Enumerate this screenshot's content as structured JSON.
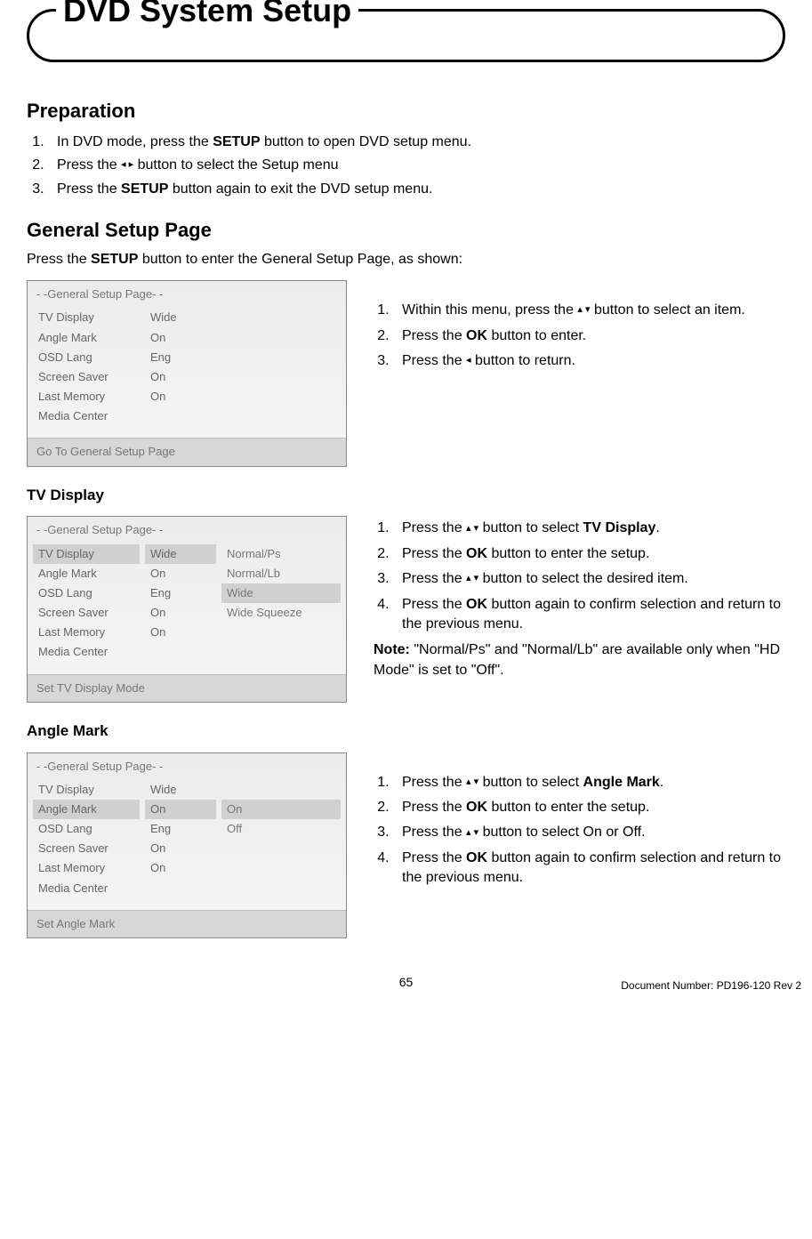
{
  "title": "DVD System Setup",
  "preparation": {
    "heading": "Preparation",
    "step1_a": "In DVD mode, press the ",
    "step1_b": "SETUP",
    "step1_c": " button to open DVD setup menu.",
    "step2_a": "Press the ",
    "step2_arrows": "◂  ▸",
    "step2_b": " button to select the Setup menu",
    "step3_a": "Press the ",
    "step3_b": "SETUP",
    "step3_c": " button again to exit the DVD setup menu."
  },
  "general": {
    "heading": "General Setup Page",
    "intro_a": "Press the ",
    "intro_b": "SETUP",
    "intro_c": " button to enter the General Setup Page, as shown:"
  },
  "menu_common": {
    "title": "- -General Setup Page- -",
    "labels": [
      "TV Display",
      "Angle Mark",
      "OSD Lang",
      "Screen Saver",
      "Last Memory",
      "Media Center"
    ],
    "vals": [
      "Wide",
      "On",
      "Eng",
      "On",
      "On",
      ""
    ]
  },
  "menu1_footer": "Go To General Setup Page",
  "steps1": {
    "s1a": "Within this menu, press the ",
    "s1arrows": "▴ ▾",
    "s1b": " button to select an item.",
    "s2a": "Press the ",
    "s2b": "OK",
    "s2c": " button to enter.",
    "s3a": "Press the ",
    "s3arrow": "◂",
    "s3b": " button to return."
  },
  "tvdisplay": {
    "subhead": "TV Display",
    "options": [
      "Normal/Ps",
      "Normal/Lb",
      "Wide",
      "Wide Squeeze"
    ],
    "sel_option_index": 2,
    "sel_label_index": 0,
    "footer": "Set TV Display Mode",
    "s1a": "Press the ",
    "s1arrows": "▴ ▾",
    "s1b": " button to select ",
    "s1c": "TV Display",
    "s1d": ".",
    "s2a": "Press the ",
    "s2b": "OK",
    "s2c": " button to enter the setup.",
    "s3a": "Press the ",
    "s3arrows": "▴ ▾",
    "s3b": " button to select the desired item.",
    "s4a": "Press the ",
    "s4b": "OK",
    "s4c": " button again to confirm selection and return to the previous menu.",
    "note_a": "Note:",
    "note_b": " \"Normal/Ps\" and \"Normal/Lb\" are available only when \"HD Mode\" is set to \"Off\"."
  },
  "angle": {
    "subhead": "Angle Mark",
    "options": [
      "On",
      "Off"
    ],
    "sel_option_index": 0,
    "sel_label_index": 1,
    "footer": "Set Angle Mark",
    "s1a": "Press the ",
    "s1arrows": "▴ ▾",
    "s1b": " button to select ",
    "s1c": "Angle Mark",
    "s1d": ".",
    "s2a": "Press the ",
    "s2b": "OK",
    "s2c": " button to enter the setup.",
    "s3a": "Press the ",
    "s3arrows": "▴ ▾",
    "s3b": " button to select On or Off.",
    "s4a": "Press the ",
    "s4b": "OK",
    "s4c": " button again to confirm selection and return to the previous menu."
  },
  "page_number": "65",
  "doc_number": "Document Number: PD196-120 Rev 2"
}
